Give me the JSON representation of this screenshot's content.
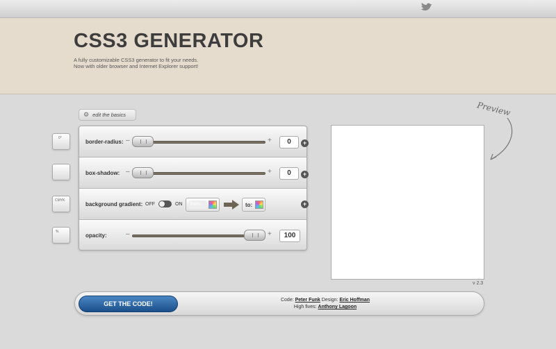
{
  "app": {
    "title": "CSS3 GENERATOR",
    "tagline_1": "A fully customizable CSS3 generator to fit your needs.",
    "tagline_2": "Now with older browser and Internet Explorer support!"
  },
  "toolbar": {
    "edit_basics_label": "edit the basics"
  },
  "side_icons": [
    {
      "name": "border-radius-icon",
      "label": "0°"
    },
    {
      "name": "box-shadow-icon",
      "label": ""
    },
    {
      "name": "gradient-icon",
      "label": "CMYK"
    },
    {
      "name": "opacity-icon",
      "label": "%"
    }
  ],
  "controls": {
    "border_radius": {
      "label": "border-radius:",
      "value": "0",
      "slider_fraction": 0.0
    },
    "box_shadow": {
      "label": "box-shadow:",
      "value": "0",
      "slider_fraction": 0.0
    },
    "background_gradient": {
      "label": "background gradient:",
      "off_label": "OFF",
      "on_label": "ON",
      "from_label": "from:",
      "to_label": "to:"
    },
    "opacity": {
      "label": "opacity:",
      "value": "100",
      "slider_fraction": 1.0
    }
  },
  "symbols": {
    "minus": "–",
    "plus": "+",
    "expand": "+"
  },
  "preview": {
    "label": "Preview",
    "version": "v 2.3"
  },
  "footer": {
    "get_code_label": "GET THE CODE!",
    "code_prefix": "Code:",
    "code_author": "Peter Funk",
    "design_prefix": "Design:",
    "design_author": "Eric Hoffman",
    "high_fives_prefix": "High fives:",
    "high_fives_author": "Anthony Lagoon"
  },
  "colors": {
    "header_bg": "#e6dccd",
    "page_bg": "#dadada",
    "button_blue": "#1b4f8a",
    "slider_track": "#7a7164"
  }
}
